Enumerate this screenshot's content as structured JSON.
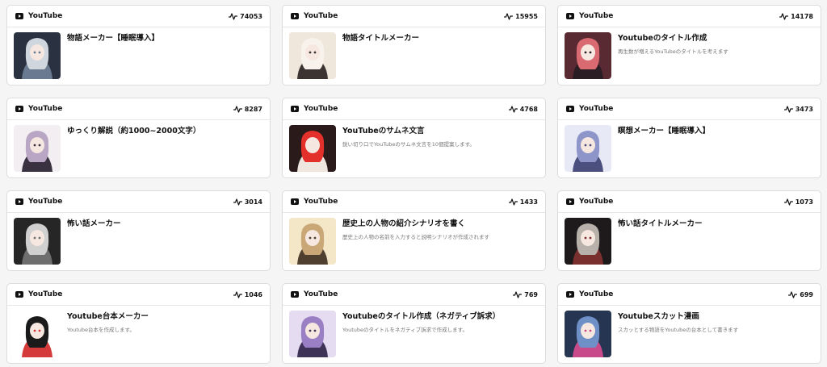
{
  "cards": [
    {
      "category": "YouTube",
      "count": "74053",
      "title": "物語メーカー【睡眠導入】",
      "description": "",
      "colors": [
        "#2a3140",
        "#cfd6de",
        "#6a7a90"
      ]
    },
    {
      "category": "YouTube",
      "count": "15955",
      "title": "物語タイトルメーカー",
      "description": "",
      "colors": [
        "#efe6dc",
        "#f7f2ec",
        "#3b3432"
      ]
    },
    {
      "category": "YouTube",
      "count": "14178",
      "title": "Youtubeのタイトル作成",
      "description": "再生数が増えるYouTubeのタイトルを考えます",
      "colors": [
        "#5a2a33",
        "#d96a72",
        "#2b1d24"
      ]
    },
    {
      "category": "YouTube",
      "count": "8287",
      "title": "ゆっくり解説（約1000~2000文字）",
      "description": "",
      "colors": [
        "#f2eef2",
        "#b9a6c4",
        "#3a3140"
      ]
    },
    {
      "category": "YouTube",
      "count": "4768",
      "title": "YouTubeのサムネ文言",
      "description": "鋭い切り口でYouTubeのサムネ文言を10個提案します。",
      "colors": [
        "#2b1a1a",
        "#e3302a",
        "#f0e6e0"
      ]
    },
    {
      "category": "YouTube",
      "count": "3473",
      "title": "瞑想メーカー【睡眠導入】",
      "description": "",
      "colors": [
        "#e7e9f7",
        "#8d95c9",
        "#4a4f7e"
      ]
    },
    {
      "category": "YouTube",
      "count": "3014",
      "title": "怖い話メーカー",
      "description": "",
      "colors": [
        "#262626",
        "#d0d0d0",
        "#6e6e6e"
      ]
    },
    {
      "category": "YouTube",
      "count": "1433",
      "title": "歴史上の人物の紹介シナリオを書く",
      "description": "歴史上の人物の名前を入力すると説明シナリオが作成されます",
      "colors": [
        "#f3e7c7",
        "#c9a777",
        "#4f3f2f"
      ]
    },
    {
      "category": "YouTube",
      "count": "1073",
      "title": "怖い話タイトルメーカー",
      "description": "",
      "colors": [
        "#1e1a1c",
        "#b8b0aa",
        "#7a2f2f"
      ]
    },
    {
      "category": "YouTube",
      "count": "1046",
      "title": "Youtube台本メーカー",
      "description": "Youtube台本を作成します。",
      "colors": [
        "#ffffff",
        "#1a1a1a",
        "#d53a3a"
      ]
    },
    {
      "category": "YouTube",
      "count": "769",
      "title": "Youtubeのタイトル作成（ネガティブ訴求）",
      "description": "Youtubeのタイトルをネガティブ訴求で作成します。",
      "colors": [
        "#e6dcf2",
        "#9b7fc4",
        "#3e3257"
      ]
    },
    {
      "category": "YouTube",
      "count": "699",
      "title": "Youtubeスカット漫画",
      "description": "スカッとする物語をYoutubeの台本として書きます",
      "colors": [
        "#263552",
        "#6f8fc7",
        "#c94a8a"
      ]
    }
  ]
}
